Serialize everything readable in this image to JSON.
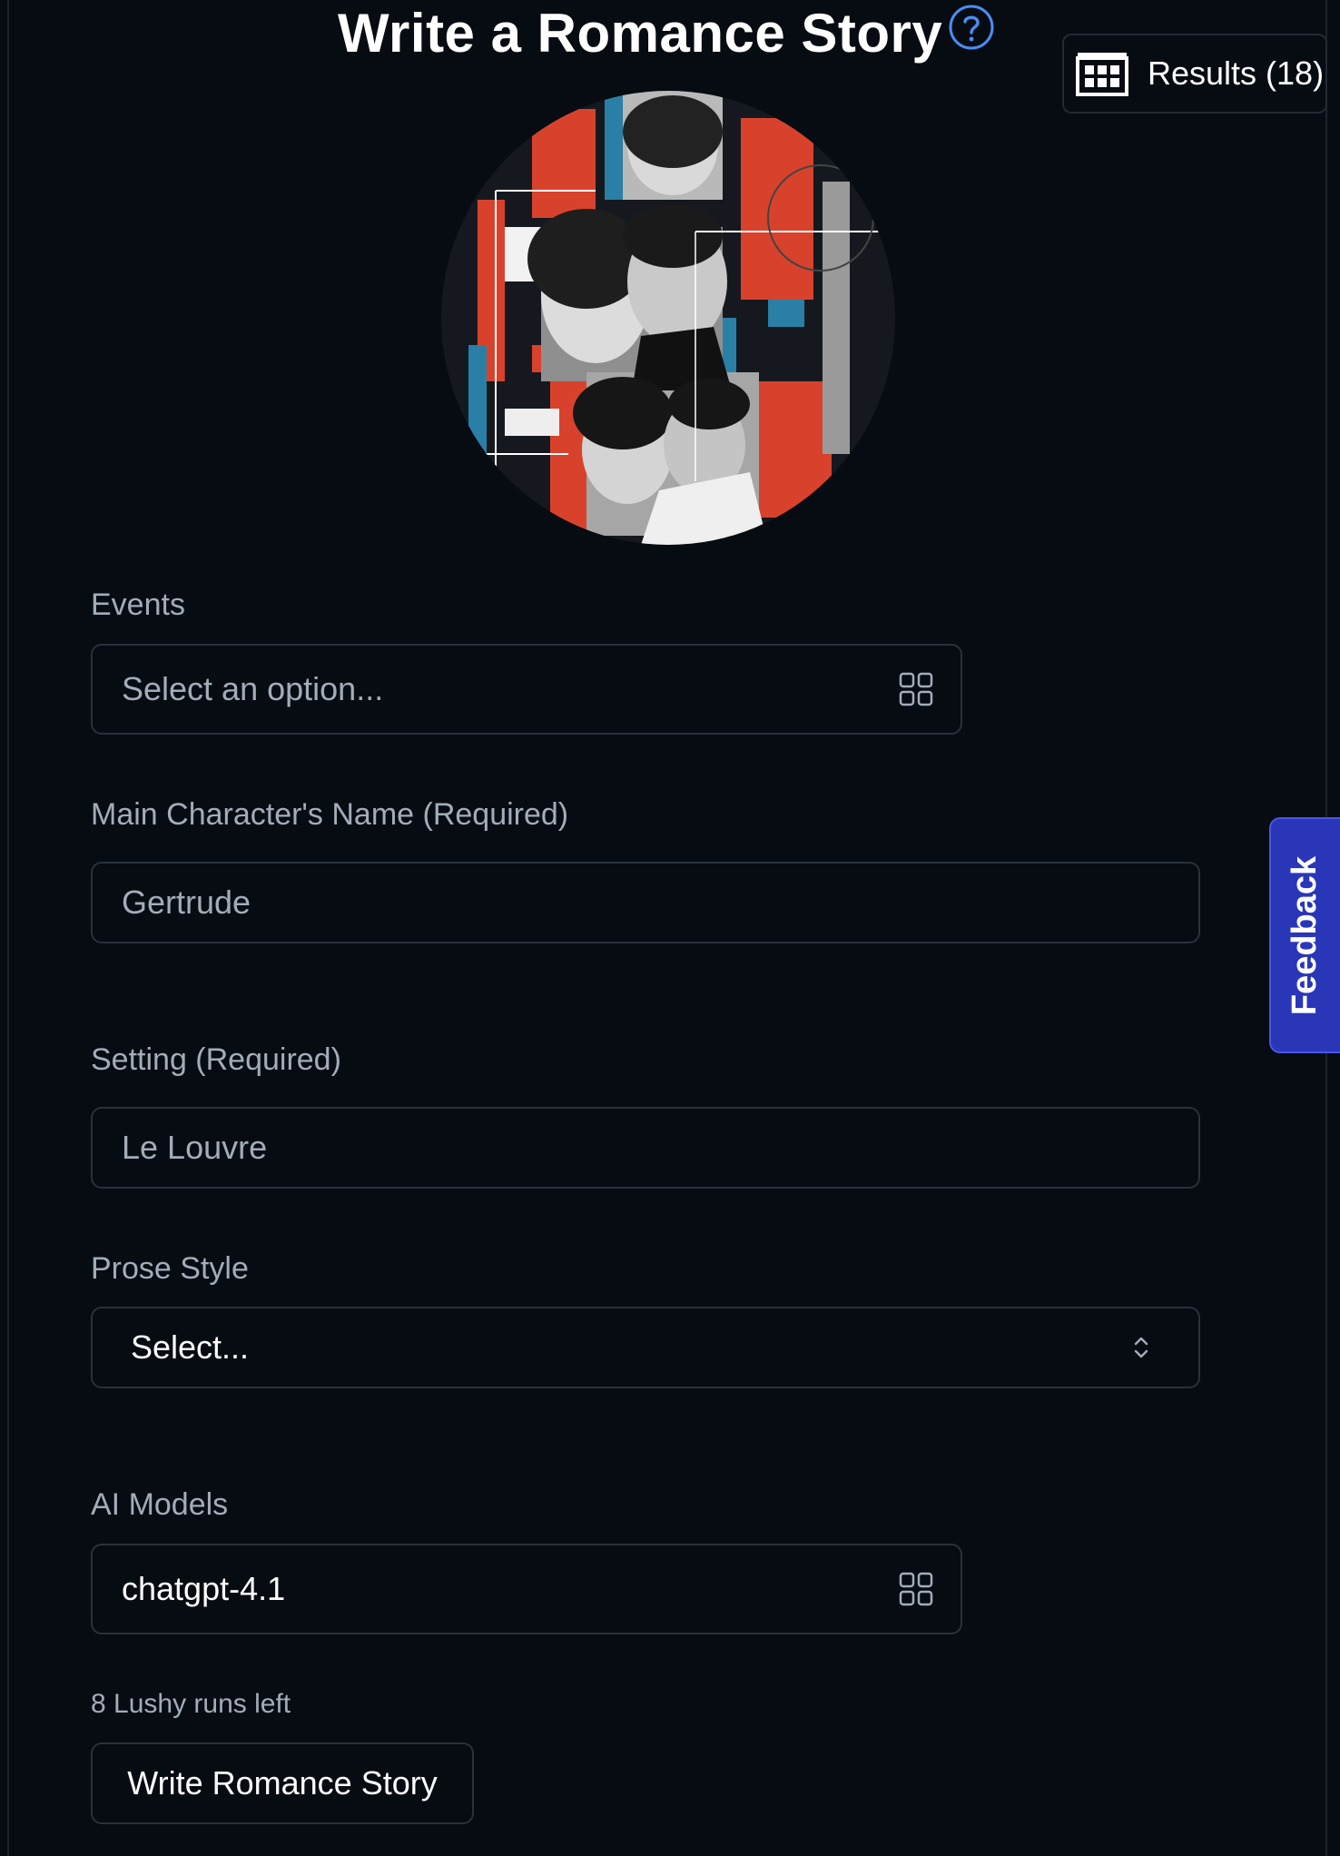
{
  "header": {
    "title": "Write a Romance Story",
    "help_icon": "question-circle-icon",
    "results_label": "Results (18)",
    "results_icon": "grid-table-icon"
  },
  "hero": {
    "icon": "romance-collage-image"
  },
  "form": {
    "events": {
      "label": "Events",
      "placeholder": "Select an option...",
      "icon": "tiles-icon"
    },
    "main_character": {
      "label": "Main Character's Name (Required)",
      "placeholder": "Gertrude"
    },
    "setting": {
      "label": "Setting (Required)",
      "placeholder": "Le Louvre"
    },
    "prose_style": {
      "label": "Prose Style",
      "value": "Select...",
      "icon": "chevron-up-down-icon"
    },
    "ai_models": {
      "label": "AI Models",
      "value": "chatgpt-4.1",
      "icon": "tiles-icon"
    }
  },
  "runs_left": "8 Lushy runs left",
  "submit_label": "Write Romance Story",
  "feedback_label": "Feedback",
  "colors": {
    "background": "#070b12",
    "accent_blue": "#4a8df0",
    "feedback_bg": "#2a36b8",
    "border": "#2a313c"
  }
}
